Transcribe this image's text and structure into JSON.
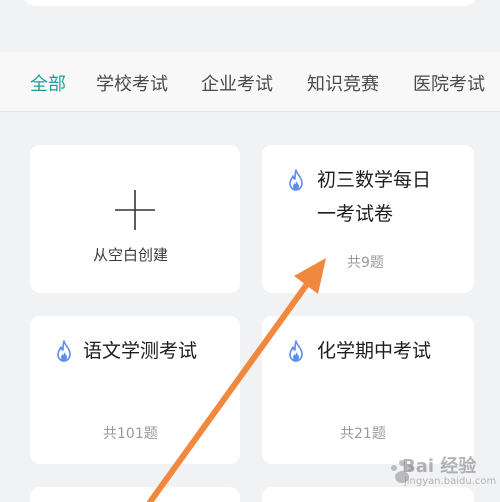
{
  "tabs": [
    {
      "label": "全部",
      "active": true
    },
    {
      "label": "学校考试",
      "active": false
    },
    {
      "label": "企业考试",
      "active": false
    },
    {
      "label": "知识竞赛",
      "active": false
    },
    {
      "label": "医院考试",
      "active": false
    }
  ],
  "create_card": {
    "label": "从空白创建",
    "icon": "plus-icon"
  },
  "templates": [
    {
      "title_line1": "初三数学每日",
      "title_line2": "一考试卷",
      "count": "共9题",
      "icon": "flame-icon"
    },
    {
      "title_line1": "语文学测考试",
      "count": "共101题",
      "icon": "flame-icon"
    },
    {
      "title_line1": "化学期中考试",
      "count": "共21题",
      "icon": "flame-icon"
    }
  ],
  "watermark": {
    "main": "Bai 经验",
    "sub": "jingyan.baidu.com"
  },
  "colors": {
    "accent": "#18a39a",
    "arrow": "#f0883e",
    "flame": "#5b8def",
    "background": "#f1f2f4"
  }
}
